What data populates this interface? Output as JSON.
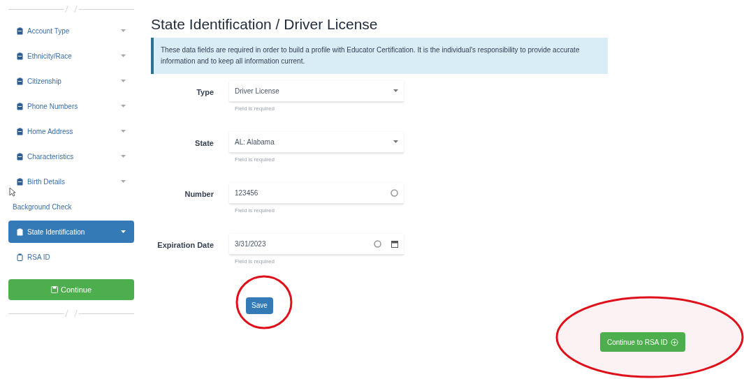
{
  "sidebar": {
    "items": [
      {
        "label": "Account Type",
        "kind": "filled",
        "caret": true,
        "selected": false
      },
      {
        "label": "Ethnicity/Race",
        "kind": "filled",
        "caret": true,
        "selected": false
      },
      {
        "label": "Citizenship",
        "kind": "filled",
        "caret": true,
        "selected": false
      },
      {
        "label": "Phone Numbers",
        "kind": "filled",
        "caret": true,
        "selected": false
      },
      {
        "label": "Home Address",
        "kind": "filled",
        "caret": true,
        "selected": false
      },
      {
        "label": "Characteristics",
        "kind": "filled",
        "caret": true,
        "selected": false
      },
      {
        "label": "Birth Details",
        "kind": "filled",
        "caret": true,
        "selected": false
      },
      {
        "label": "Background Check",
        "kind": "plain",
        "caret": false,
        "selected": false
      },
      {
        "label": "State Identification",
        "kind": "filled",
        "caret": true,
        "selected": true
      },
      {
        "label": "RSA ID",
        "kind": "outline",
        "caret": false,
        "selected": false
      }
    ],
    "continue_button": "Continue"
  },
  "title": "State Identification / Driver License",
  "notice": "These data fields are required in order to build a profile with Educator Certification. It is the individual's responsibility to provide accurate information and to keep all information current.",
  "fields": [
    {
      "label": "Type",
      "kind": "select",
      "value": "Driver License",
      "help": "Field is required"
    },
    {
      "label": "State",
      "kind": "select",
      "value": "AL: Alabama",
      "help": "Field is required"
    },
    {
      "label": "Number",
      "kind": "text",
      "value": "123456",
      "help": "Field is required"
    },
    {
      "label": "Expiration Date",
      "kind": "date",
      "value": "3/31/2023",
      "help": "Field is required"
    }
  ],
  "save_button": "Save",
  "next_button": "Continue to RSA ID"
}
